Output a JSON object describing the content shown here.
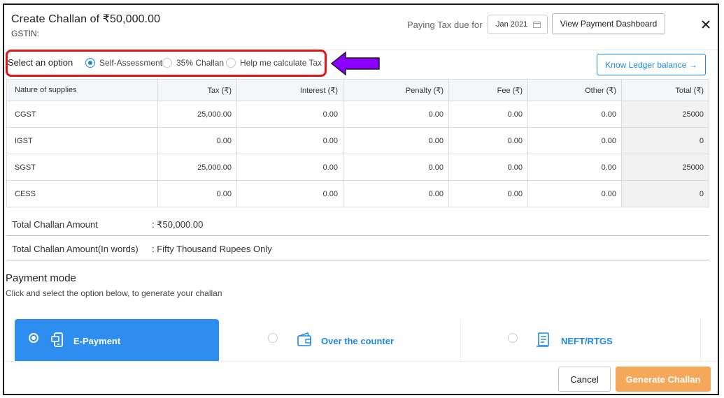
{
  "header": {
    "title": "Create Challan of ₹50,000.00",
    "gstin_label": "GSTIN:",
    "paying_tax_label": "Paying Tax due for",
    "period_value": "Jan 2021",
    "calendar_icon": "calendar-icon",
    "dashboard_button": "View Payment Dashboard",
    "close_icon": "close-icon"
  },
  "options": {
    "label": "Select an option",
    "items": [
      {
        "label": "Self-Assessment",
        "selected": true
      },
      {
        "label": "35% Challan",
        "selected": false
      },
      {
        "label": "Help me calculate Tax",
        "selected": false
      }
    ],
    "highlight_color": "#e0161b",
    "arrow_color": "#8b00ff"
  },
  "ledger_button": "Know Ledger balance →",
  "table": {
    "headers": [
      "Nature of supplies",
      "Tax (₹)",
      "Interest (₹)",
      "Penalty (₹)",
      "Fee (₹)",
      "Other (₹)",
      "Total (₹)"
    ],
    "rows": [
      [
        "CGST",
        "25,000.00",
        "0.00",
        "0.00",
        "0.00",
        "0.00",
        "25000"
      ],
      [
        "IGST",
        "0.00",
        "0.00",
        "0.00",
        "0.00",
        "0.00",
        "0"
      ],
      [
        "SGST",
        "25,000.00",
        "0.00",
        "0.00",
        "0.00",
        "0.00",
        "25000"
      ],
      [
        "CESS",
        "0.00",
        "0.00",
        "0.00",
        "0.00",
        "0.00",
        "0"
      ]
    ]
  },
  "summary": {
    "total_label": "Total Challan Amount",
    "total_value": ": ₹50,000.00",
    "words_label": "Total Challan Amount(In words)",
    "words_value": ": Fifty Thousand Rupees Only"
  },
  "payment_mode": {
    "title": "Payment mode",
    "subtitle": "Click and select the option below, to generate your challan",
    "options": [
      {
        "label": "E-Payment",
        "icon": "mobile-payment-icon",
        "selected": true
      },
      {
        "label": "Over the counter",
        "icon": "wallet-icon",
        "selected": false
      },
      {
        "label": "NEFT/RTGS",
        "icon": "receipt-icon",
        "selected": false
      }
    ]
  },
  "footer": {
    "cancel": "Cancel",
    "generate": "Generate Challan"
  },
  "colors": {
    "accent": "#1e88e5",
    "active_card": "#2d8ef0",
    "generate_button": "#f5a859"
  }
}
